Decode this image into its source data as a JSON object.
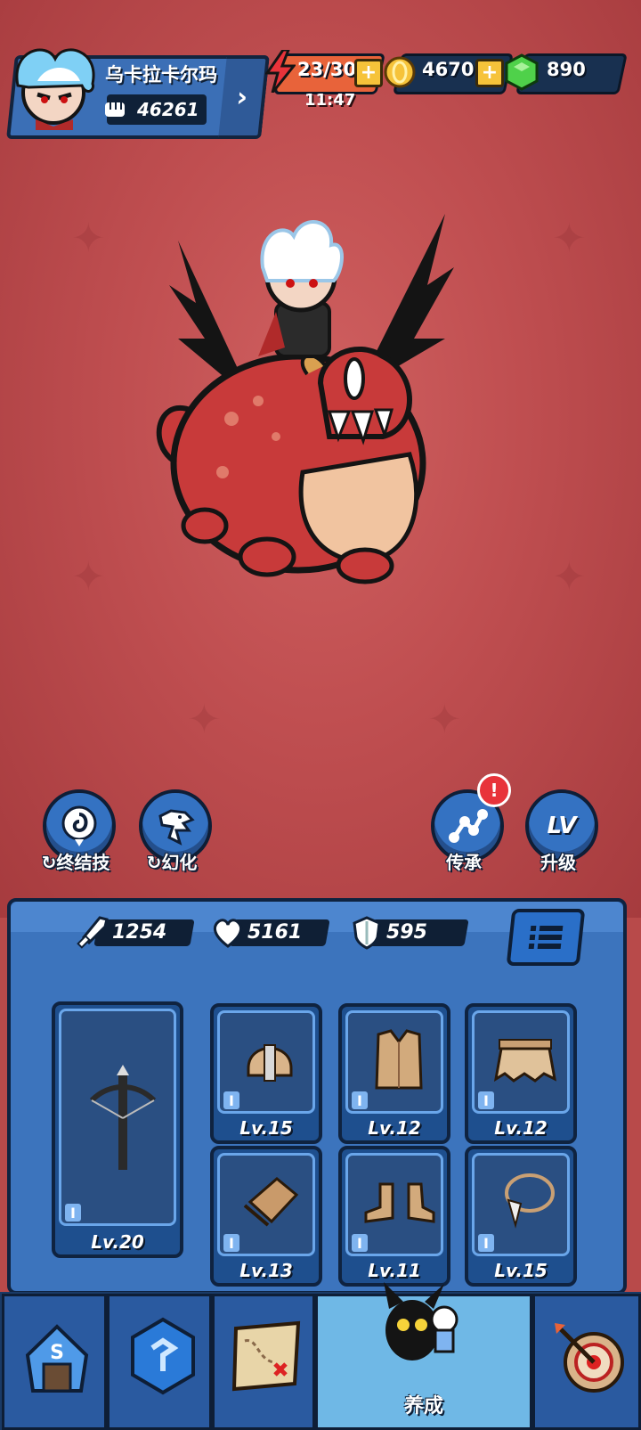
{
  "player": {
    "name": "乌卡拉卡尔玛",
    "power": "46261"
  },
  "resources": {
    "energy": "23/30",
    "energy_timer": "11:47",
    "gold": "4670",
    "gems": "890"
  },
  "skills": [
    {
      "label": "终结技",
      "icon": "spiral-emblem-icon"
    },
    {
      "label": "幻化",
      "icon": "dragon-head-icon"
    },
    {
      "label": "传承",
      "icon": "node-link-icon",
      "alert": "!"
    },
    {
      "label": "升级",
      "icon": "level-up-icon",
      "glyph": "LV"
    }
  ],
  "stats": {
    "attack": "1254",
    "health": "5161",
    "defense": "595"
  },
  "equipment": [
    {
      "slot": "weapon",
      "icon": "crossbow-icon",
      "quality": "I",
      "level": "Lv.20"
    },
    {
      "slot": "helmet",
      "icon": "helmet-icon",
      "quality": "I",
      "level": "Lv.15"
    },
    {
      "slot": "armor",
      "icon": "vest-icon",
      "quality": "I",
      "level": "Lv.12"
    },
    {
      "slot": "belt",
      "icon": "belt-skirt-icon",
      "quality": "I",
      "level": "Lv.12"
    },
    {
      "slot": "gloves",
      "icon": "bracer-icon",
      "quality": "I",
      "level": "Lv.13"
    },
    {
      "slot": "boots",
      "icon": "boots-icon",
      "quality": "I",
      "level": "Lv.11"
    },
    {
      "slot": "necklace",
      "icon": "necklace-icon",
      "quality": "I",
      "level": "Lv.15"
    }
  ],
  "nav": {
    "active_label": "养成"
  },
  "colors": {
    "background": "#bf4e50",
    "panel": "#3c74bd",
    "accent": "#f6c33a",
    "gem": "#4fd14a"
  }
}
